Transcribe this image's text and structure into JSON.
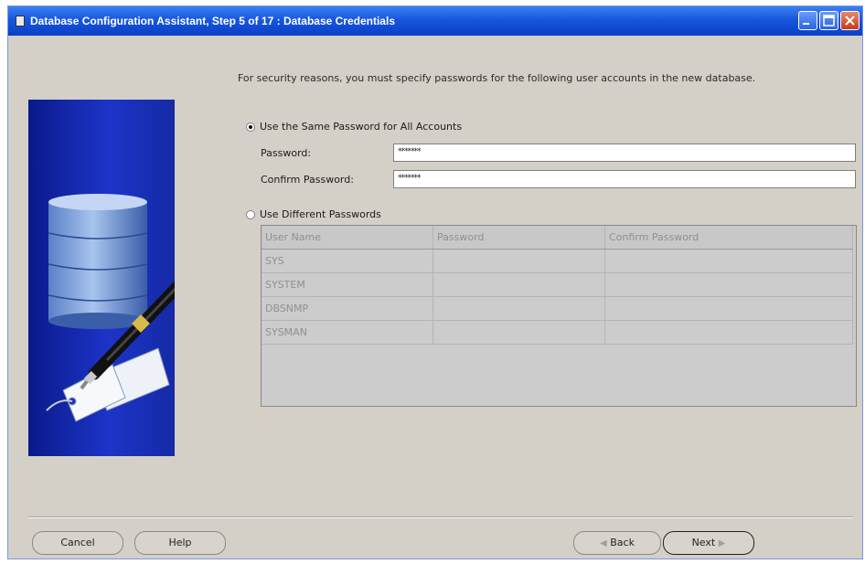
{
  "window": {
    "title": "Database Configuration Assistant, Step 5 of 17 : Database Credentials"
  },
  "intro_text": "For security reasons, you must specify passwords for the following user accounts in the new database.",
  "same_password": {
    "label": "Use the Same Password for All Accounts",
    "selected": true,
    "password_label": "Password:",
    "password_value": "*******",
    "confirm_label": "Confirm Password:",
    "confirm_value": "*******"
  },
  "different_passwords": {
    "label": "Use Different Passwords",
    "selected": false,
    "columns": [
      "User Name",
      "Password",
      "Confirm Password"
    ],
    "rows": [
      [
        "SYS",
        "",
        ""
      ],
      [
        "SYSTEM",
        "",
        ""
      ],
      [
        "DBSNMP",
        "",
        ""
      ],
      [
        "SYSMAN",
        "",
        ""
      ]
    ]
  },
  "buttons": {
    "cancel": "Cancel",
    "help": "Help",
    "back": "Back",
    "next": "Next"
  },
  "colors": {
    "title_bar": "#1856de",
    "dialog_bg": "#d4d0c8",
    "art_bg": "#1c34c8"
  },
  "icons": [
    "window-icon",
    "minimize-icon",
    "maximize-icon",
    "close-icon",
    "database-pen-illustration",
    "back-arrow-icon",
    "next-arrow-icon"
  ]
}
